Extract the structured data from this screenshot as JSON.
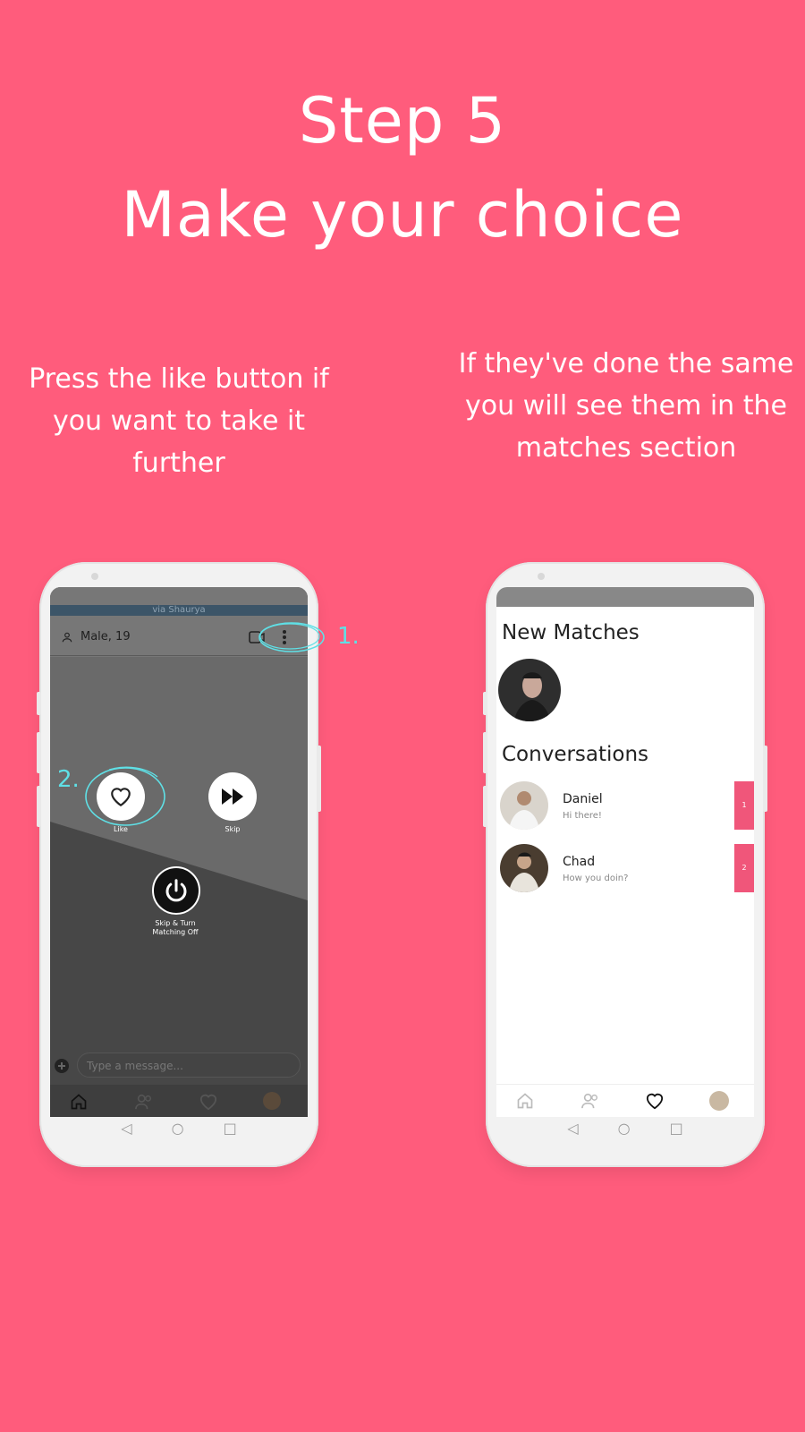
{
  "heading": {
    "step": "Step 5",
    "subtitle": "Make your choice"
  },
  "left_panel": {
    "description": "Press the like button if you want to take it further",
    "annotation_1": "1.",
    "annotation_2": "2.",
    "screen": {
      "banner": "via Shaurya",
      "profile_label": "Male, 19",
      "like_label": "Like",
      "skip_label": "Skip",
      "power_label_line1": "Skip & Turn",
      "power_label_line2": "Matching Off",
      "message_placeholder": "Type a message..."
    }
  },
  "right_panel": {
    "description": "If they've done the same you will see them in the matches section",
    "screen": {
      "new_matches_title": "New Matches",
      "conversations_title": "Conversations",
      "conversations": [
        {
          "name": "Daniel",
          "message": "Hi there!",
          "badge": "1"
        },
        {
          "name": "Chad",
          "message": "How you doin?",
          "badge": "2"
        }
      ]
    }
  },
  "colors": {
    "background": "#ff5c7c",
    "annotation": "#5fe0e6",
    "badge": "#f0567a"
  }
}
